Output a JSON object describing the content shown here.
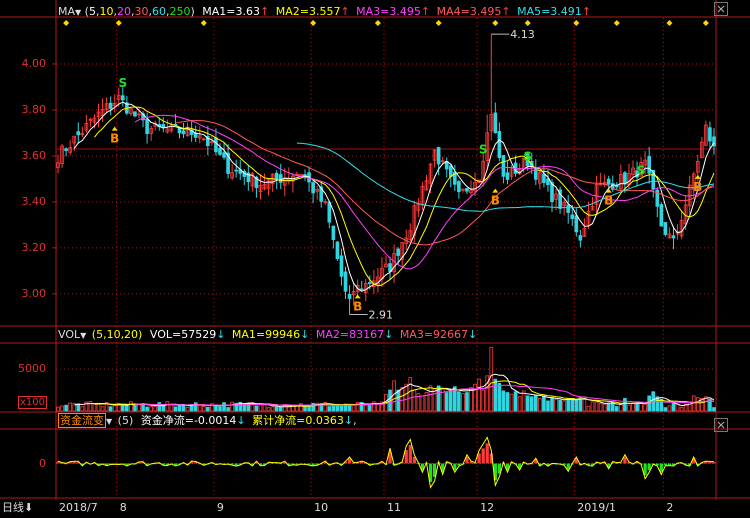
{
  "main_header": {
    "indicator": "MA",
    "params_open": "(",
    "params": [
      "5",
      "10",
      "20",
      "30",
      "60",
      "250"
    ],
    "params_close": ")",
    "ma1": "MA1=3.63",
    "ma2": "MA2=3.557",
    "ma3": "MA3=3.495",
    "ma4": "MA4=3.495",
    "ma5": "MA5=3.491",
    "up_arrow": "↑"
  },
  "vol_header": {
    "indicator": "VOL",
    "params": "(5,10,20)",
    "vol": "VOL=57529",
    "ma1": "MA1=99946",
    "ma2": "MA2=83167",
    "ma3": "MA3=92667",
    "down_arrow": "↓"
  },
  "flow_header": {
    "indicator": "资金流变",
    "params": "(5)",
    "net": "资金净流=-0.0014",
    "cum": "累计净流=0.0363",
    "down_arrow": "↓",
    "tail": ","
  },
  "footer": {
    "period": "日线",
    "period_arrow": "⬇"
  },
  "colors": {
    "axis": "#b01818",
    "up": "#ff3c3c",
    "down": "#2fd5e0",
    "ma1": "#ffffff",
    "ma2": "#ffff00",
    "ma3": "#ff40ff",
    "ma4": "#ff5a5a",
    "ma5": "#30e0e8",
    "signal_b": "#ff8c00",
    "signal_s": "#20e020",
    "marker": "#ffd700"
  },
  "chart_data": [
    {
      "type": "candlestick",
      "panel": "price",
      "ylim": [
        2.86,
        4.2
      ],
      "yticks": [
        "4.00",
        "3.80",
        "3.60",
        "3.40",
        "3.20",
        "3.00"
      ],
      "ytick_values": [
        4.0,
        3.8,
        3.6,
        3.4,
        3.2,
        3.0
      ],
      "annotations": [
        {
          "label": "4.13",
          "value": 4.13,
          "index": 107
        },
        {
          "label": "2.91",
          "value": 2.91,
          "index": 72
        }
      ],
      "reference_value": 3.63,
      "x_labels": [
        {
          "label": "2018/7",
          "index": 0
        },
        {
          "label": "8",
          "index": 15
        },
        {
          "label": "9",
          "index": 39
        },
        {
          "label": "10",
          "index": 63
        },
        {
          "label": "11",
          "index": 81
        },
        {
          "label": "12",
          "index": 104
        },
        {
          "label": "2019/1",
          "index": 128
        },
        {
          "label": "2",
          "index": 150
        }
      ],
      "num_bars": 163,
      "signals": [
        {
          "type": "B",
          "index": 14,
          "price": 3.71
        },
        {
          "type": "S",
          "index": 16,
          "price": 3.9
        },
        {
          "type": "B",
          "index": 74,
          "price": 2.98
        },
        {
          "type": "S",
          "index": 105,
          "price": 3.61
        },
        {
          "type": "B",
          "index": 108,
          "price": 3.44
        },
        {
          "type": "S",
          "index": 116,
          "price": 3.58
        },
        {
          "type": "B",
          "index": 136,
          "price": 3.44
        },
        {
          "type": "S",
          "index": 144,
          "price": 3.52
        },
        {
          "type": "B",
          "index": 158,
          "price": 3.5
        }
      ],
      "waypoints": [
        [
          0,
          3.6
        ],
        [
          10,
          3.78
        ],
        [
          15,
          3.85
        ],
        [
          22,
          3.72
        ],
        [
          35,
          3.7
        ],
        [
          42,
          3.55
        ],
        [
          50,
          3.48
        ],
        [
          60,
          3.53
        ],
        [
          66,
          3.38
        ],
        [
          71,
          3.0
        ],
        [
          76,
          3.04
        ],
        [
          82,
          3.12
        ],
        [
          87,
          3.3
        ],
        [
          93,
          3.62
        ],
        [
          99,
          3.42
        ],
        [
          104,
          3.52
        ],
        [
          107,
          3.78
        ],
        [
          110,
          3.5
        ],
        [
          116,
          3.58
        ],
        [
          121,
          3.45
        ],
        [
          126,
          3.35
        ],
        [
          129,
          3.25
        ],
        [
          133,
          3.46
        ],
        [
          140,
          3.5
        ],
        [
          145,
          3.56
        ],
        [
          149,
          3.3
        ],
        [
          152,
          3.22
        ],
        [
          156,
          3.45
        ],
        [
          160,
          3.72
        ],
        [
          162,
          3.63
        ]
      ],
      "series": [
        {
          "key": "ma1",
          "period": 5
        },
        {
          "key": "ma2",
          "period": 10
        },
        {
          "key": "ma3",
          "period": 20
        },
        {
          "key": "ma4",
          "period": 30
        },
        {
          "key": "ma5",
          "period": 60
        }
      ]
    },
    {
      "type": "bar",
      "panel": "volume",
      "ylim": [
        0,
        8000
      ],
      "yticks": [
        "5000"
      ],
      "ytick_values": [
        5000
      ],
      "unit_label": "x100",
      "base_level": 800,
      "spikes": [
        [
          81,
          2000
        ],
        [
          82,
          2500
        ],
        [
          83,
          3600
        ],
        [
          84,
          2500
        ],
        [
          85,
          2800
        ],
        [
          86,
          3200
        ],
        [
          87,
          4000
        ],
        [
          88,
          2500
        ],
        [
          89,
          2100
        ],
        [
          90,
          1800
        ],
        [
          91,
          2200
        ],
        [
          92,
          3000
        ],
        [
          93,
          2700
        ],
        [
          94,
          3000
        ],
        [
          95,
          2600
        ],
        [
          96,
          2200
        ],
        [
          97,
          2500
        ],
        [
          98,
          2900
        ],
        [
          99,
          2300
        ],
        [
          100,
          2100
        ],
        [
          101,
          2200
        ],
        [
          102,
          2800
        ],
        [
          103,
          3200
        ],
        [
          104,
          3800
        ],
        [
          105,
          2500
        ],
        [
          106,
          4200
        ],
        [
          107,
          7600
        ],
        [
          108,
          3800
        ],
        [
          109,
          3300
        ],
        [
          110,
          2400
        ],
        [
          111,
          2200
        ],
        [
          112,
          2000
        ],
        [
          113,
          2300
        ],
        [
          114,
          1700
        ],
        [
          115,
          2400
        ],
        [
          116,
          1800
        ],
        [
          117,
          1700
        ],
        [
          118,
          1900
        ],
        [
          119,
          1500
        ],
        [
          120,
          1800
        ],
        [
          121,
          1200
        ],
        [
          122,
          1600
        ],
        [
          123,
          1400
        ],
        [
          124,
          1300
        ],
        [
          125,
          1200
        ],
        [
          126,
          1400
        ],
        [
          127,
          1500
        ],
        [
          128,
          1300
        ],
        [
          129,
          1600
        ],
        [
          130,
          1700
        ],
        [
          140,
          1500
        ],
        [
          146,
          1800
        ],
        [
          147,
          2300
        ],
        [
          148,
          1700
        ],
        [
          149,
          1400
        ],
        [
          157,
          1800
        ],
        [
          158,
          1600
        ],
        [
          159,
          1500
        ],
        [
          160,
          1700
        ],
        [
          161,
          1400
        ]
      ]
    },
    {
      "type": "bar",
      "panel": "fund_flow",
      "ylim": [
        -1,
        1
      ],
      "yticks": [
        "0"
      ],
      "ytick_values": [
        0
      ],
      "spikes": [
        [
          72,
          0.15
        ],
        [
          80,
          0.05
        ],
        [
          82,
          0.35
        ],
        [
          86,
          0.4
        ],
        [
          87,
          0.55
        ],
        [
          88,
          0.2
        ],
        [
          90,
          -0.2
        ],
        [
          92,
          -0.55
        ],
        [
          93,
          -0.4
        ],
        [
          95,
          -0.25
        ],
        [
          98,
          -0.2
        ],
        [
          101,
          0.2
        ],
        [
          104,
          0.3
        ],
        [
          105,
          0.45
        ],
        [
          106,
          0.6
        ],
        [
          107,
          0.3
        ],
        [
          108,
          -0.5
        ],
        [
          109,
          -0.3
        ],
        [
          111,
          -0.2
        ],
        [
          114,
          -0.15
        ],
        [
          118,
          0.12
        ],
        [
          126,
          -0.18
        ],
        [
          128,
          0.15
        ],
        [
          136,
          -0.12
        ],
        [
          140,
          0.2
        ],
        [
          145,
          -0.35
        ],
        [
          146,
          -0.2
        ],
        [
          149,
          -0.25
        ],
        [
          157,
          0.15
        ]
      ]
    }
  ]
}
